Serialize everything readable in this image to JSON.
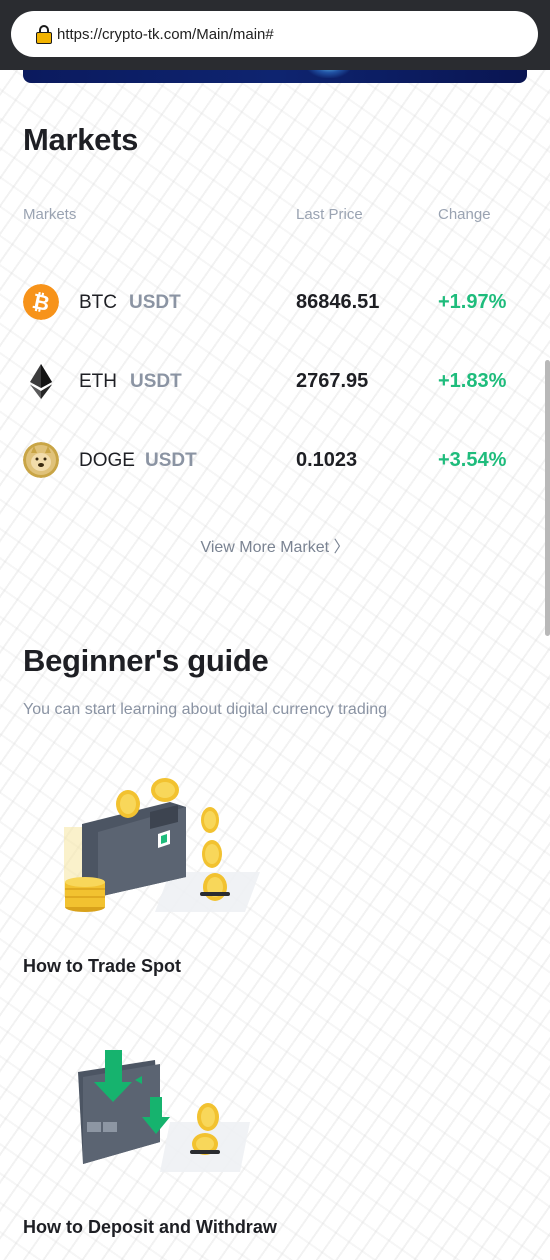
{
  "browser": {
    "url": "https://crypto-tk.com/Main/main#"
  },
  "markets": {
    "title": "Markets",
    "columns": {
      "market": "Markets",
      "price": "Last Price",
      "change": "Change"
    },
    "rows": [
      {
        "symbol": "BTC",
        "quote": "USDT",
        "price": "86846.51",
        "change": "+1.97%",
        "icon": "bitcoin-icon"
      },
      {
        "symbol": "ETH",
        "quote": "USDT",
        "price": "2767.95",
        "change": "+1.83%",
        "icon": "ethereum-icon"
      },
      {
        "symbol": "DOGE",
        "quote": "USDT",
        "price": "0.1023",
        "change": "+3.54%",
        "icon": "dogecoin-icon"
      }
    ],
    "view_more": "View More Market 〉"
  },
  "guide": {
    "title": "Beginner's guide",
    "subtitle": "You can start learning about digital currency trading",
    "items": [
      {
        "label": "How to Trade Spot",
        "icon": "wallet-coins-illustration"
      },
      {
        "label": "How to Deposit and Withdraw",
        "icon": "card-deposit-illustration"
      }
    ]
  },
  "colors": {
    "accent_green": "#1ebc7c",
    "muted": "#9aa3b2",
    "text": "#1e1f24"
  }
}
